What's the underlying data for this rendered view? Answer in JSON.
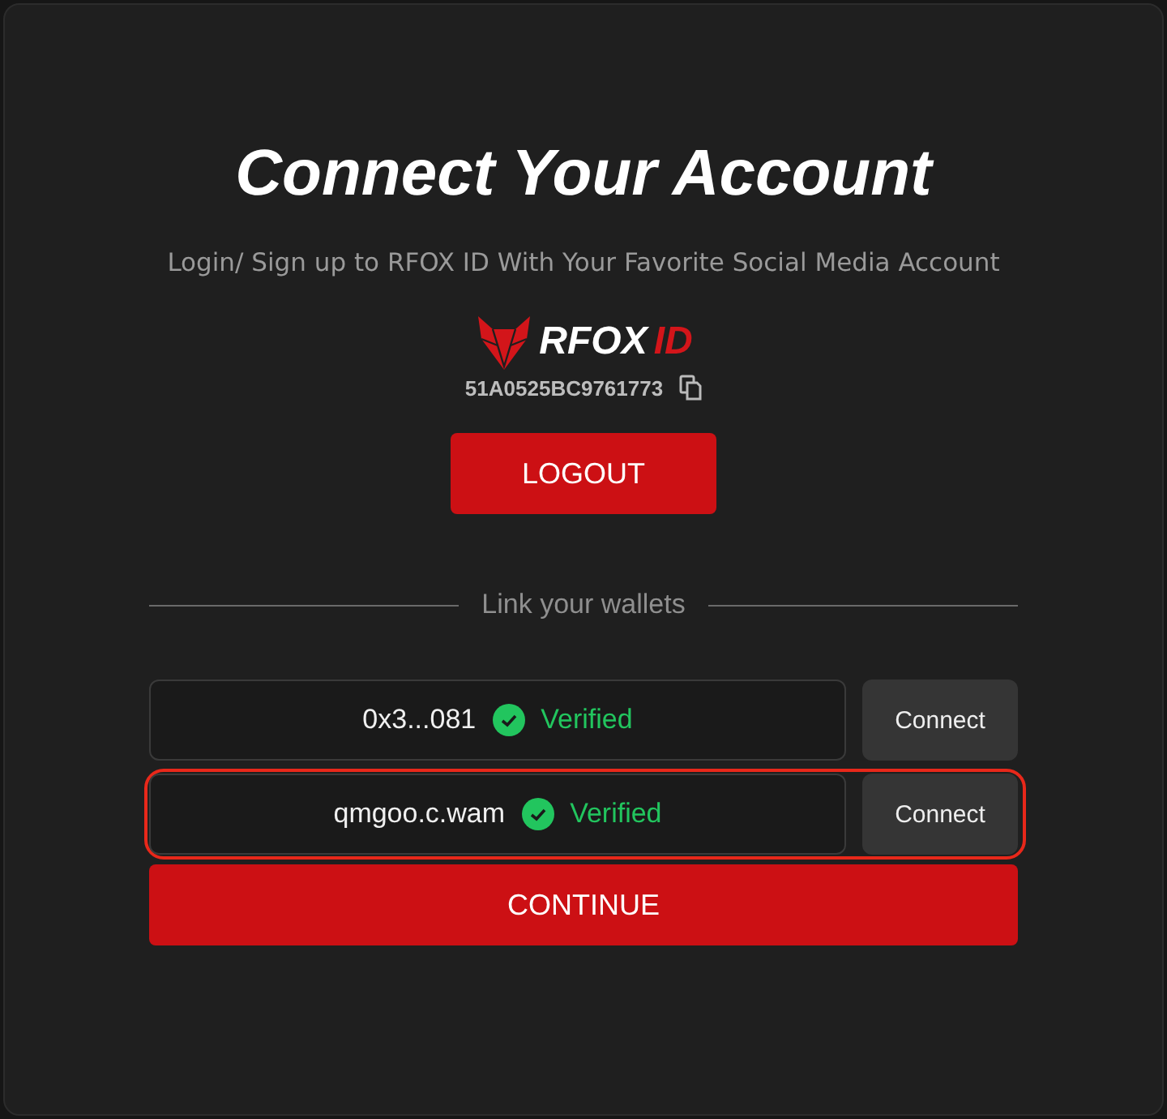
{
  "title": "Connect Your Account",
  "subtitle": "Login/ Sign up to RFOX ID With Your Favorite Social Media Account",
  "logo": {
    "brand": "RFOX",
    "suffix": "ID"
  },
  "account_id": "51A0525BC9761773",
  "logout_button": "LOGOUT",
  "divider_label": "Link your wallets",
  "wallets": [
    {
      "address": "0x3...081",
      "status": "Verified",
      "verified": true,
      "button": "Connect",
      "selected": false
    },
    {
      "address": "qmgoo.c.wam",
      "status": "Verified",
      "verified": true,
      "button": "Connect",
      "selected": true
    }
  ],
  "continue_button": "CONTINUE"
}
